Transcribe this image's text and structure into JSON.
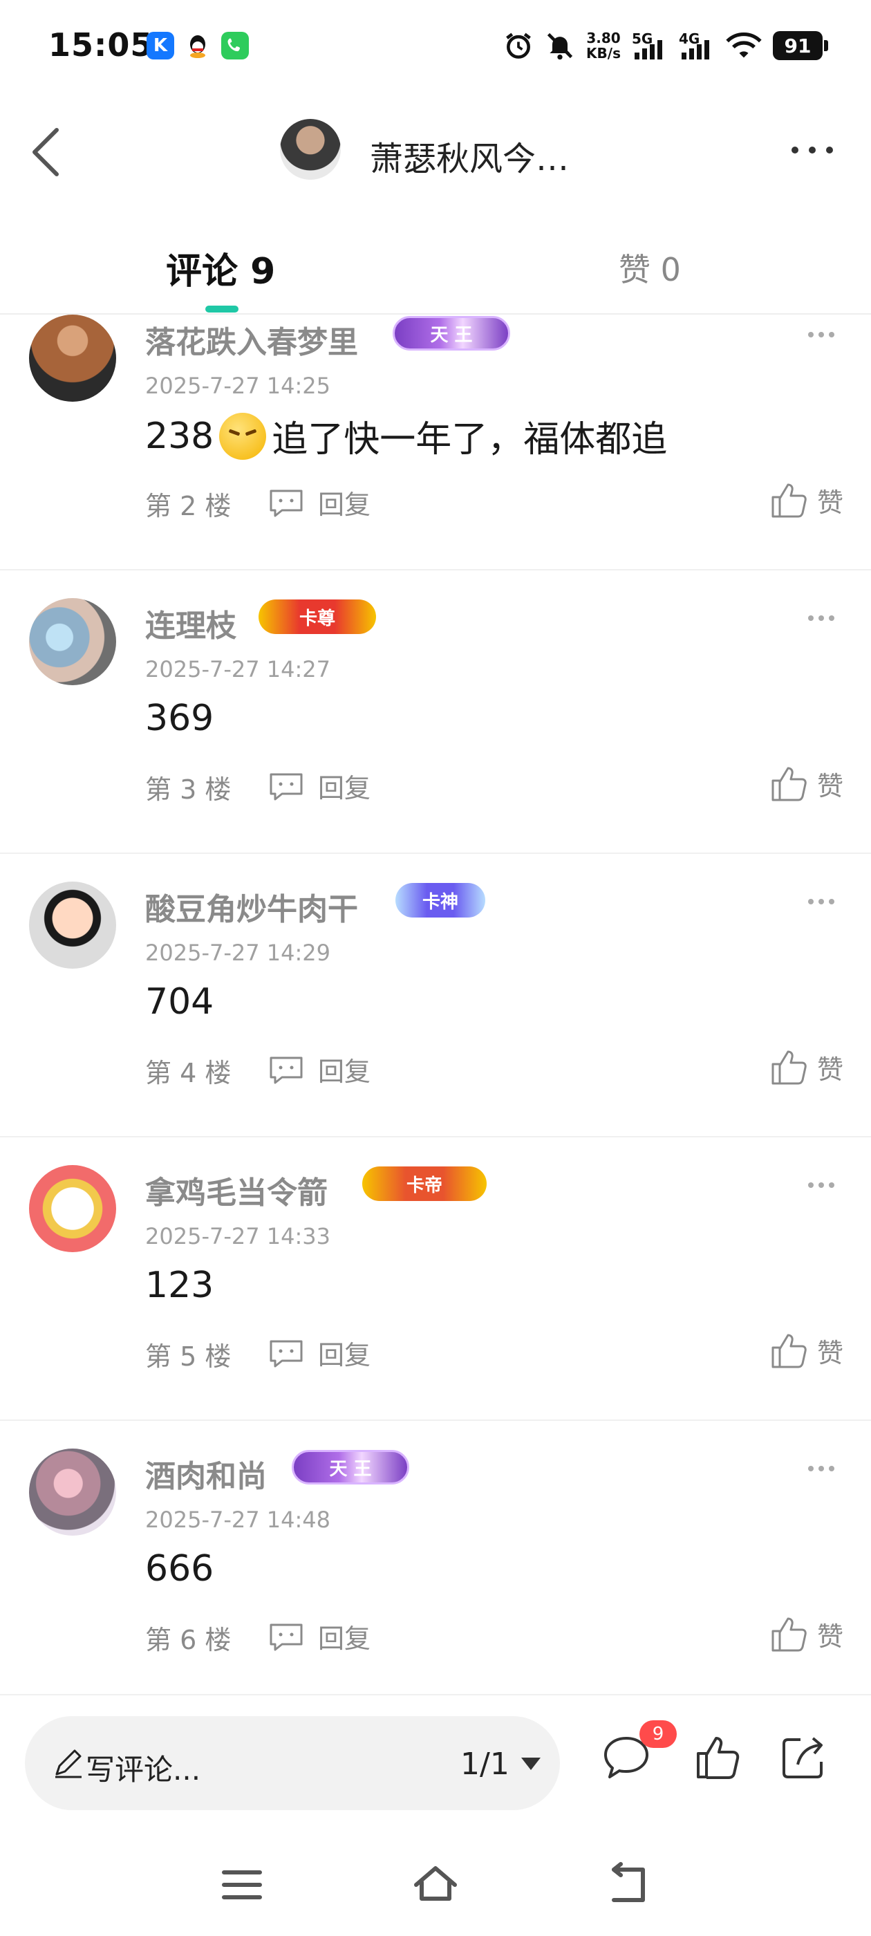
{
  "status_bar": {
    "time": "15:05",
    "speed_value": "3.80",
    "speed_unit": "KB/s",
    "net1": "5G",
    "net2": "4G",
    "battery": "91",
    "icons": [
      "k-app-icon",
      "qq-icon",
      "phone-app-icon",
      "alarm-icon",
      "mute-icon",
      "signal-icon",
      "wifi-icon"
    ]
  },
  "header": {
    "title": "萧瑟秋风今…"
  },
  "tabs": {
    "comments": "评论 9",
    "likes": "赞 0"
  },
  "comments": [
    {
      "name": "落花跌入春梦里",
      "badge": "天 王",
      "time": "2025-7-27 14:25",
      "text": "238",
      "text_after_emoji": "追了快一年了，福体都追",
      "has_emoji": true,
      "floor": "第 2 楼",
      "reply": "回复",
      "like": "赞"
    },
    {
      "name": "连理枝",
      "badge": "卡尊",
      "time": "2025-7-27 14:27",
      "text": "369",
      "floor": "第 3 楼",
      "reply": "回复",
      "like": "赞"
    },
    {
      "name": "酸豆角炒牛肉干",
      "badge": "卡神",
      "time": "2025-7-27 14:29",
      "text": "704",
      "floor": "第 4 楼",
      "reply": "回复",
      "like": "赞"
    },
    {
      "name": "拿鸡毛当令箭",
      "badge": "卡帝",
      "time": "2025-7-27 14:33",
      "text": "123",
      "floor": "第 5 楼",
      "reply": "回复",
      "like": "赞"
    },
    {
      "name": "酒肉和尚",
      "badge": "天 王",
      "time": "2025-7-27 14:48",
      "text": "666",
      "floor": "第 6 楼",
      "reply": "回复",
      "like": "赞"
    }
  ],
  "bottom_bar": {
    "placeholder": "写评论...",
    "page": "1/1",
    "comment_count": "9"
  },
  "colors": {
    "accent": "#1fc8a6",
    "badge_red": "#ff4b4b",
    "meta_gray": "#8a8a8a"
  }
}
